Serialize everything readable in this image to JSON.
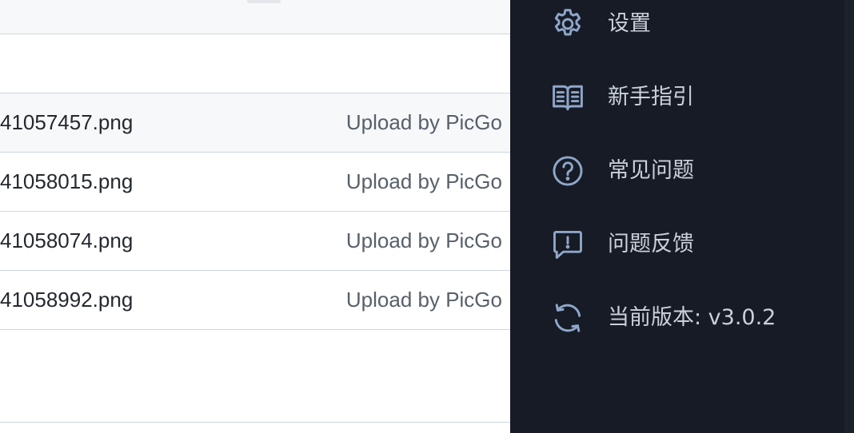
{
  "files": {
    "rows": [
      {
        "name": "41057457.png",
        "description": "Upload by PicGo"
      },
      {
        "name": "41058015.png",
        "description": "Upload by PicGo"
      },
      {
        "name": "41058074.png",
        "description": "Upload by PicGo"
      },
      {
        "name": "41058992.png",
        "description": "Upload by PicGo"
      }
    ]
  },
  "menu": {
    "items": [
      {
        "label": "设置",
        "icon": "gear-icon"
      },
      {
        "label": "新手指引",
        "icon": "book-icon"
      },
      {
        "label": "常见问题",
        "icon": "question-circle-icon"
      },
      {
        "label": "问题反馈",
        "icon": "feedback-icon"
      },
      {
        "label": "当前版本: v3.0.2",
        "icon": "sync-icon"
      }
    ]
  },
  "colors": {
    "menu_bg": "#161b26",
    "menu_text": "#c9d1d9",
    "icon_stroke": "#8fa6c8",
    "row_hover": "#f6f8fa",
    "border": "#d0d7de"
  }
}
